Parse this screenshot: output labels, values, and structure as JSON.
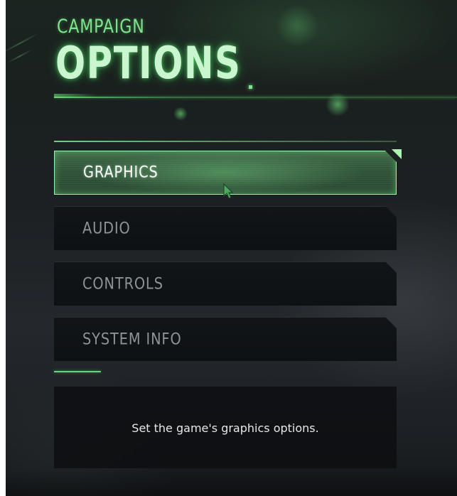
{
  "header": {
    "subtitle": "CAMPAIGN",
    "title": "OPTIONS"
  },
  "menu": {
    "items": [
      {
        "label": "GRAPHICS",
        "selected": true
      },
      {
        "label": "AUDIO",
        "selected": false
      },
      {
        "label": "CONTROLS",
        "selected": false
      },
      {
        "label": "SYSTEM INFO",
        "selected": false
      }
    ]
  },
  "description": {
    "text": "Set the game's graphics options."
  },
  "colors": {
    "accent": "#6bd37b",
    "selected_fill": "#2f5238",
    "selected_border": "#9ff0aa",
    "item_fill": "#0e1113",
    "item_text": "#8d9496",
    "panel_fill": "#0c0e10"
  },
  "icons": {
    "cursor": "mouse-pointer-icon"
  }
}
